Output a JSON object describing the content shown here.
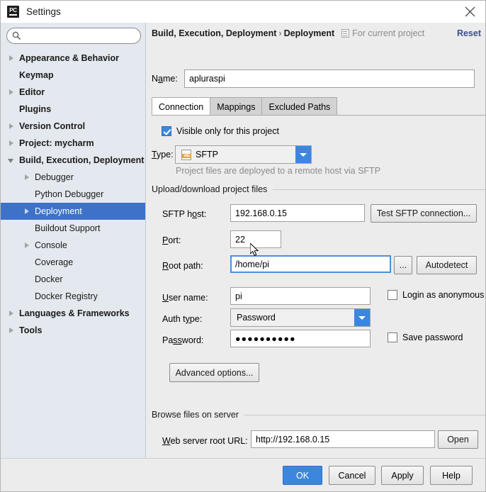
{
  "window": {
    "title": "Settings",
    "logo_icon": "pycharm-logo-icon",
    "close_icon": "close-icon"
  },
  "sidebar": {
    "search": {
      "placeholder": "",
      "value": "",
      "icon": "search-icon"
    },
    "items": [
      {
        "label": "Appearance & Behavior",
        "arrow": "right",
        "indent": 0,
        "bold": true,
        "selected": false
      },
      {
        "label": "Keymap",
        "arrow": "none",
        "indent": 0,
        "bold": true,
        "selected": false
      },
      {
        "label": "Editor",
        "arrow": "right",
        "indent": 0,
        "bold": true,
        "selected": false
      },
      {
        "label": "Plugins",
        "arrow": "none",
        "indent": 0,
        "bold": true,
        "selected": false
      },
      {
        "label": "Version Control",
        "arrow": "right",
        "indent": 0,
        "bold": true,
        "selected": false
      },
      {
        "label": "Project: mycharm",
        "arrow": "right",
        "indent": 0,
        "bold": true,
        "selected": false
      },
      {
        "label": "Build, Execution, Deployment",
        "arrow": "down",
        "indent": 0,
        "bold": true,
        "selected": false
      },
      {
        "label": "Debugger",
        "arrow": "right",
        "indent": 1,
        "bold": false,
        "selected": false
      },
      {
        "label": "Python Debugger",
        "arrow": "none",
        "indent": 1,
        "bold": false,
        "selected": false
      },
      {
        "label": "Deployment",
        "arrow": "right",
        "indent": 1,
        "bold": false,
        "selected": true
      },
      {
        "label": "Buildout Support",
        "arrow": "none",
        "indent": 1,
        "bold": false,
        "selected": false
      },
      {
        "label": "Console",
        "arrow": "right",
        "indent": 1,
        "bold": false,
        "selected": false
      },
      {
        "label": "Coverage",
        "arrow": "none",
        "indent": 1,
        "bold": false,
        "selected": false
      },
      {
        "label": "Docker",
        "arrow": "none",
        "indent": 1,
        "bold": false,
        "selected": false
      },
      {
        "label": "Docker Registry",
        "arrow": "none",
        "indent": 1,
        "bold": false,
        "selected": false
      },
      {
        "label": "Languages & Frameworks",
        "arrow": "right",
        "indent": 0,
        "bold": true,
        "selected": false
      },
      {
        "label": "Tools",
        "arrow": "right",
        "indent": 0,
        "bold": true,
        "selected": false
      }
    ]
  },
  "header": {
    "breadcrumb_parent": "Build, Execution, Deployment",
    "breadcrumb_sep": "›",
    "breadcrumb_current": "Deployment",
    "for_current_project": "For current project",
    "for_current_project_icon": "module-icon",
    "reset_label": "Reset"
  },
  "main": {
    "name_label": "Name:",
    "name_value": "apluraspi",
    "tabs": [
      {
        "label": "Connection",
        "active": true
      },
      {
        "label": "Mappings",
        "active": false
      },
      {
        "label": "Excluded Paths",
        "active": false
      }
    ],
    "visible_only": {
      "label": "Visible only for this project",
      "checked": true
    },
    "type_label": "Type:",
    "type_value": "SFTP",
    "type_icon": "sftp-file-icon",
    "type_hint": "Project files are deployed to a remote host via SFTP",
    "upload_group": {
      "title": "Upload/download project files",
      "sftp_host_label": "SFTP host:",
      "sftp_host_value": "192.168.0.15",
      "test_connection_label": "Test SFTP connection...",
      "port_label": "Port:",
      "port_value": "22",
      "root_path_label": "Root path:",
      "root_path_value": "/home/pi",
      "root_path_focused": true,
      "browse_label": "...",
      "autodetect_label": "Autodetect",
      "user_name_label": "User name:",
      "user_name_value": "pi",
      "login_anonymous": {
        "label": "Login as anonymous",
        "checked": false
      },
      "auth_type_label": "Auth type:",
      "auth_type_value": "Password",
      "password_label": "Password:",
      "password_value": "●●●●●●●●●●",
      "save_password": {
        "label": "Save password",
        "checked": false
      },
      "advanced_options_label": "Advanced options..."
    },
    "browse_group": {
      "title": "Browse files on server",
      "web_url_label": "Web server root URL:",
      "web_url_value": "http://192.168.0.15",
      "open_label": "Open"
    }
  },
  "footer": {
    "ok_label": "OK",
    "cancel_label": "Cancel",
    "apply_label": "Apply",
    "help_label": "Help"
  },
  "colors": {
    "accent_blue": "#3d86e0",
    "selection_blue": "#3d72c8",
    "sidebar_bg": "#e4e9ef",
    "panel_bg": "#ececec",
    "link_blue": "#3b4f8f"
  }
}
